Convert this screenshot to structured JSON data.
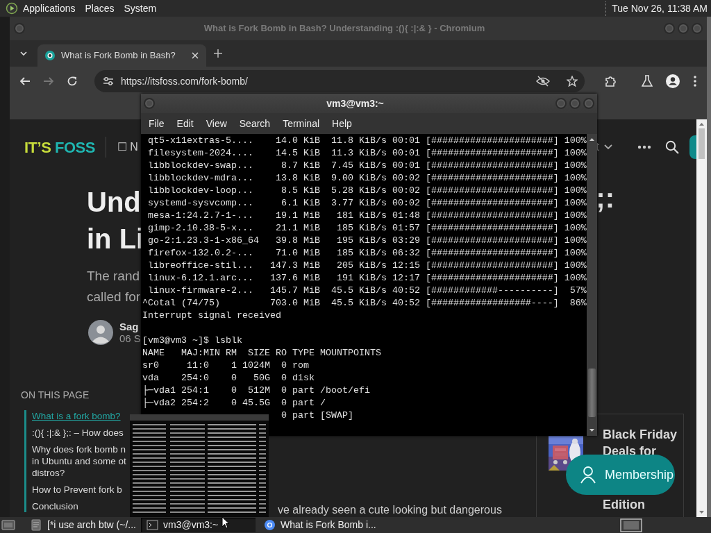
{
  "panel": {
    "menus": [
      "Applications",
      "Places",
      "System"
    ],
    "clock": "Tue Nov 26, 11:38 AM"
  },
  "browser": {
    "title": "What is Fork Bomb in Bash? Understanding :(){ :|:& } - Chromium",
    "tabs": [
      {
        "label": "What is Fork Bomb in Bash?",
        "selected": true
      }
    ],
    "forward_enabled": false,
    "url": "https://itsfoss.com/fork-bomb/",
    "page": {
      "logo": {
        "first": "IT’S",
        "second": "FOSS"
      },
      "nav_left": "☐ N",
      "nav_right": "t",
      "heading": [
        "Und",
        "in Li"
      ],
      "heading_tail": ";:",
      "subtitle": [
        "The rand",
        "called for"
      ],
      "author": {
        "name": "Sag",
        "date": "06 S"
      },
      "toc": {
        "title": "ON THIS PAGE",
        "items": [
          {
            "lines": [
              "What is a fork bomb?"
            ],
            "selected": true
          },
          {
            "lines": [
              ":(){ :|:& };: – How does"
            ],
            "selected": false
          },
          {
            "lines": [
              "Why does fork bomb n",
              "in Ubuntu and some ot",
              "distros?"
            ],
            "selected": false
          },
          {
            "lines": [
              "How to Prevent fork b"
            ],
            "selected": false
          },
          {
            "lines": [
              "Conclusion"
            ],
            "selected": false
          }
        ]
      },
      "body_text": "ve already seen a cute looking but dangerous",
      "promo": {
        "top_lines": [
          "Black Friday",
          "Deals for"
        ],
        "bottom_line": "Edition"
      },
      "membership": "Membership"
    }
  },
  "terminal": {
    "title": "vm3@vm3:~",
    "menus": [
      "File",
      "Edit",
      "View",
      "Search",
      "Terminal",
      "Help"
    ],
    "blocks": [
      {
        "lines": [
          " qt5-x11extras-5....    14.0 KiB  11.8 KiB/s 00:01 [######################] 100%",
          " filesystem-2024....    14.5 KiB  11.3 KiB/s 00:01 [######################] 100%",
          " libblockdev-swap...     8.7 KiB  7.45 KiB/s 00:01 [######################] 100%",
          " libblockdev-mdra...    13.8 KiB  9.00 KiB/s 00:02 [######################] 100%",
          " libblockdev-loop...     8.5 KiB  5.28 KiB/s 00:02 [######################] 100%",
          " systemd-sysvcomp...     6.1 KiB  3.77 KiB/s 00:02 [######################] 100%",
          " mesa-1:24.2.7-1-...    19.1 MiB   181 KiB/s 01:48 [######################] 100%",
          " gimp-2.10.38-5-x...    21.1 MiB   185 KiB/s 01:57 [######################] 100%",
          " go-2:1.23.3-1-x86_64   39.8 MiB   195 KiB/s 03:29 [######################] 100%",
          " firefox-132.0.2-...    71.0 MiB   185 KiB/s 06:32 [######################] 100%",
          " libreoffice-stil...   147.3 MiB   205 KiB/s 12:15 [######################] 100%",
          " linux-6.12.1.arc...   137.6 MiB   191 KiB/s 12:17 [######################] 100%",
          " linux-firmware-2...   145.7 MiB  45.5 KiB/s 40:52 [############----------]  57%",
          "^Cotal (74/75)         703.0 MiB  45.5 KiB/s 40:52 [##################----]  86%",
          "Interrupt signal received"
        ]
      },
      {
        "lines": [
          "[vm3@vm3 ~]$ lsblk",
          "NAME   MAJ:MIN RM  SIZE RO TYPE MOUNTPOINTS",
          "sr0     11:0    1 1024M  0 rom",
          "vda    254:0    0   50G  0 disk",
          "├─vda1 254:1    0  512M  0 part /boot/efi",
          "├─vda2 254:2    0 45.5G  0 part /"
        ]
      }
    ],
    "cut_line": "0 part [SWAP]"
  },
  "taskbar": {
    "tasks": [
      {
        "label": "[*i use arch btw (~/...",
        "kind": "editor",
        "selected": false
      },
      {
        "label": "vm3@vm3:~",
        "kind": "terminal",
        "selected": true
      },
      {
        "label": "What is Fork Bomb i...",
        "kind": "browser",
        "selected": false
      }
    ]
  }
}
